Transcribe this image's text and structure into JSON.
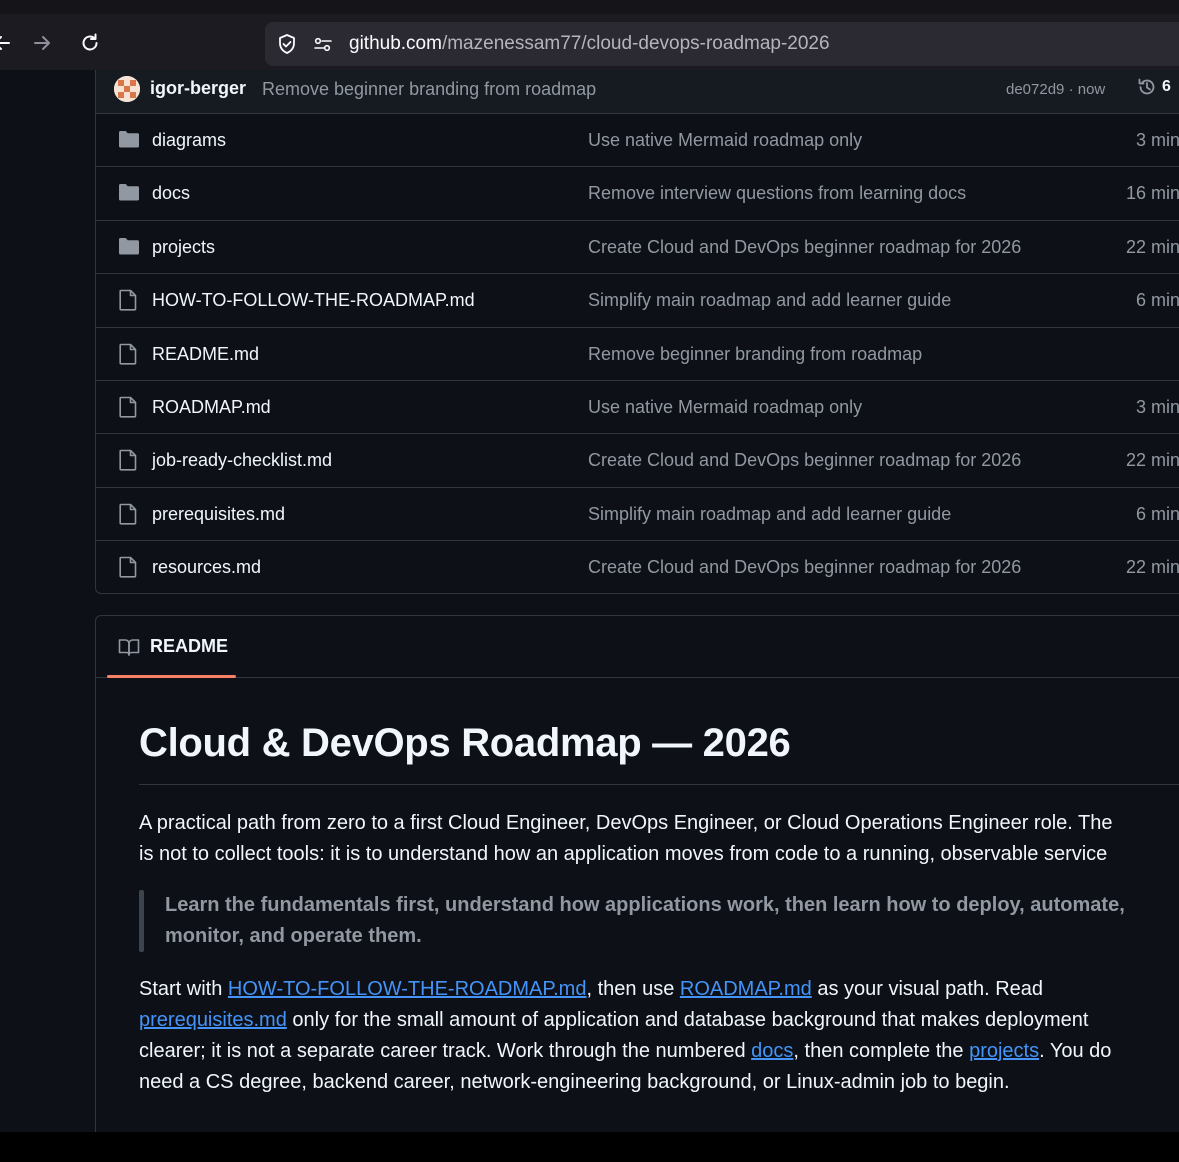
{
  "browser": {
    "url_host": "github.com",
    "url_path": "/mazenessam77/cloud-devops-roadmap-2026"
  },
  "commit": {
    "author": "igor-berger",
    "message": "Remove beginner branding from roadmap",
    "meta": "de072d9 · now",
    "history_count": "6"
  },
  "files": [
    {
      "type": "dir",
      "name": "diagrams",
      "commit": "Use native Mermaid roadmap only",
      "time": "3 min"
    },
    {
      "type": "dir",
      "name": "docs",
      "commit": "Remove interview questions from learning docs",
      "time": "16 min"
    },
    {
      "type": "dir",
      "name": "projects",
      "commit": "Create Cloud and DevOps beginner roadmap for 2026",
      "time": "22 min"
    },
    {
      "type": "file",
      "name": "HOW-TO-FOLLOW-THE-ROADMAP.md",
      "commit": "Simplify main roadmap and add learner guide",
      "time": "6 min"
    },
    {
      "type": "file",
      "name": "README.md",
      "commit": "Remove beginner branding from roadmap",
      "time": ""
    },
    {
      "type": "file",
      "name": "ROADMAP.md",
      "commit": "Use native Mermaid roadmap only",
      "time": "3 min"
    },
    {
      "type": "file",
      "name": "job-ready-checklist.md",
      "commit": "Create Cloud and DevOps beginner roadmap for 2026",
      "time": "22 min"
    },
    {
      "type": "file",
      "name": "prerequisites.md",
      "commit": "Simplify main roadmap and add learner guide",
      "time": "6 min"
    },
    {
      "type": "file",
      "name": "resources.md",
      "commit": "Create Cloud and DevOps beginner roadmap for 2026",
      "time": "22 min"
    }
  ],
  "readme": {
    "tab_label": "README",
    "title": "Cloud & DevOps Roadmap — 2026",
    "intro_line1": "A practical path from zero to a first Cloud Engineer, DevOps Engineer, or Cloud Operations Engineer role. The",
    "intro_line2": "is not to collect tools: it is to understand how an application moves from code to a running, observable service",
    "quote_line1": "Learn the fundamentals first, understand how applications work, then learn how to deploy, automate,",
    "quote_line2": "monitor, and operate them.",
    "p2_start": "Start with ",
    "link_howto": "HOW-TO-FOLLOW-THE-ROADMAP.md",
    "p2_mid1": ", then use ",
    "link_roadmap": "ROADMAP.md",
    "p2_mid2": " as your visual path. Read",
    "link_prereq": "prerequisites.md",
    "p2_line2_rest": " only for the small amount of application and database background that makes deployment",
    "p2_line3_start": "clearer; it is not a separate career track. Work through the numbered ",
    "link_docs": "docs",
    "p2_line3_mid": ", then complete the ",
    "link_projects": "projects",
    "p2_line3_end": ". You do",
    "p2_line4": "need a CS degree, backend career, network-engineering background, or Linux-admin job to begin."
  }
}
